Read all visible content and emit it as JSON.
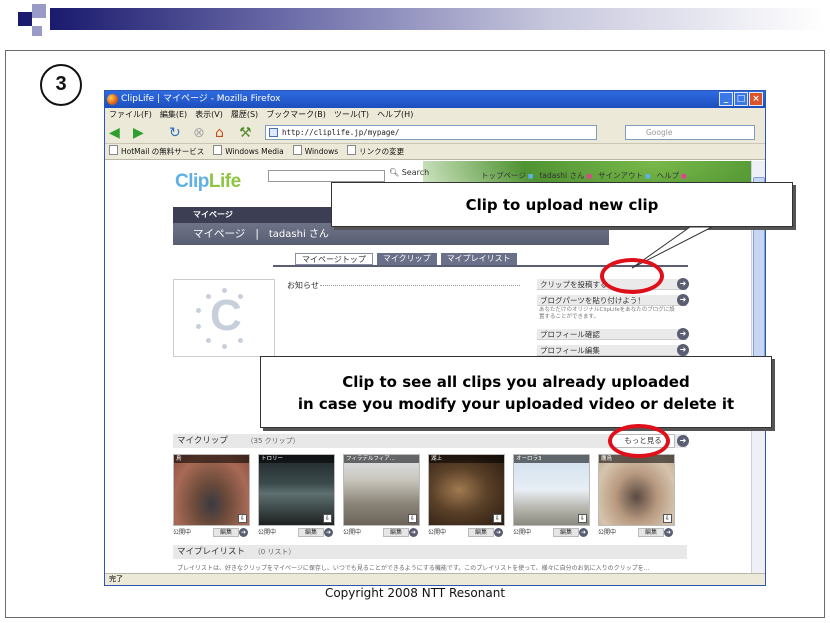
{
  "slide": {
    "step_number": "3",
    "copyright": "Copyright 2008 NTT Resonant",
    "callouts": {
      "upload": "Clip to upload new clip",
      "see_all_line1": "Clip to see all clips you already uploaded",
      "see_all_line2": "in case you modify your uploaded video or delete it"
    }
  },
  "browser": {
    "window_title": "ClipLife | マイページ - Mozilla Firefox",
    "menu": [
      "ファイル(F)",
      "編集(E)",
      "表示(V)",
      "履歴(S)",
      "ブックマーク(B)",
      "ツール(T)",
      "ヘルプ(H)"
    ],
    "url": "http://cliplife.jp/mypage/",
    "search_placeholder": "Google",
    "bookmarks": [
      "HotMail の無料サービス",
      "Windows Media",
      "Windows",
      "リンクの変更"
    ],
    "status": "完了"
  },
  "site": {
    "logo_clip": "Clip",
    "logo_life": "Life",
    "search_button": "Search",
    "top_links": [
      "トップページ",
      "tadashi さん",
      "サインアウト",
      "ヘルプ"
    ],
    "mypage_header": "マイページ",
    "mypage_title": "マイページ",
    "user_name": "tadashi さん",
    "tabs": [
      "マイページトップ",
      "マイクリップ",
      "マイプレイリスト"
    ],
    "notice_title": "お知らせ",
    "side_buttons": [
      "クリップを投稿する",
      "ブログパーツを貼り付けよう！",
      "プロフィール確認",
      "プロフィール編集"
    ],
    "side_note": "あなただけのオリジナルClipLifeをあなたのブログに設置することができます。",
    "myclip_title": "マイクリップ",
    "myclip_count": "（35 クリップ）",
    "more_button": "もっと見る",
    "thumbs": [
      {
        "title": "鳥",
        "status": "公開中",
        "edit": "編集"
      },
      {
        "title": "トロリー",
        "status": "公開中",
        "edit": "編集"
      },
      {
        "title": "フィラデルフィア...",
        "status": "公開中",
        "edit": "編集"
      },
      {
        "title": "湖上",
        "status": "公開中",
        "edit": "編集"
      },
      {
        "title": "オーロラ3",
        "status": "公開中",
        "edit": "編集"
      },
      {
        "title": "鷹鳥",
        "status": "公開中",
        "edit": "編集"
      }
    ],
    "playlist_title": "マイプレイリスト",
    "playlist_count": "（0 リスト）",
    "playlist_desc": "プレイリストは、好きなクリップをマイページに保存し、いつでも見ることができるようにする機能です。このプレイリストを使って、様々に自分のお気に入りのクリップを..."
  }
}
